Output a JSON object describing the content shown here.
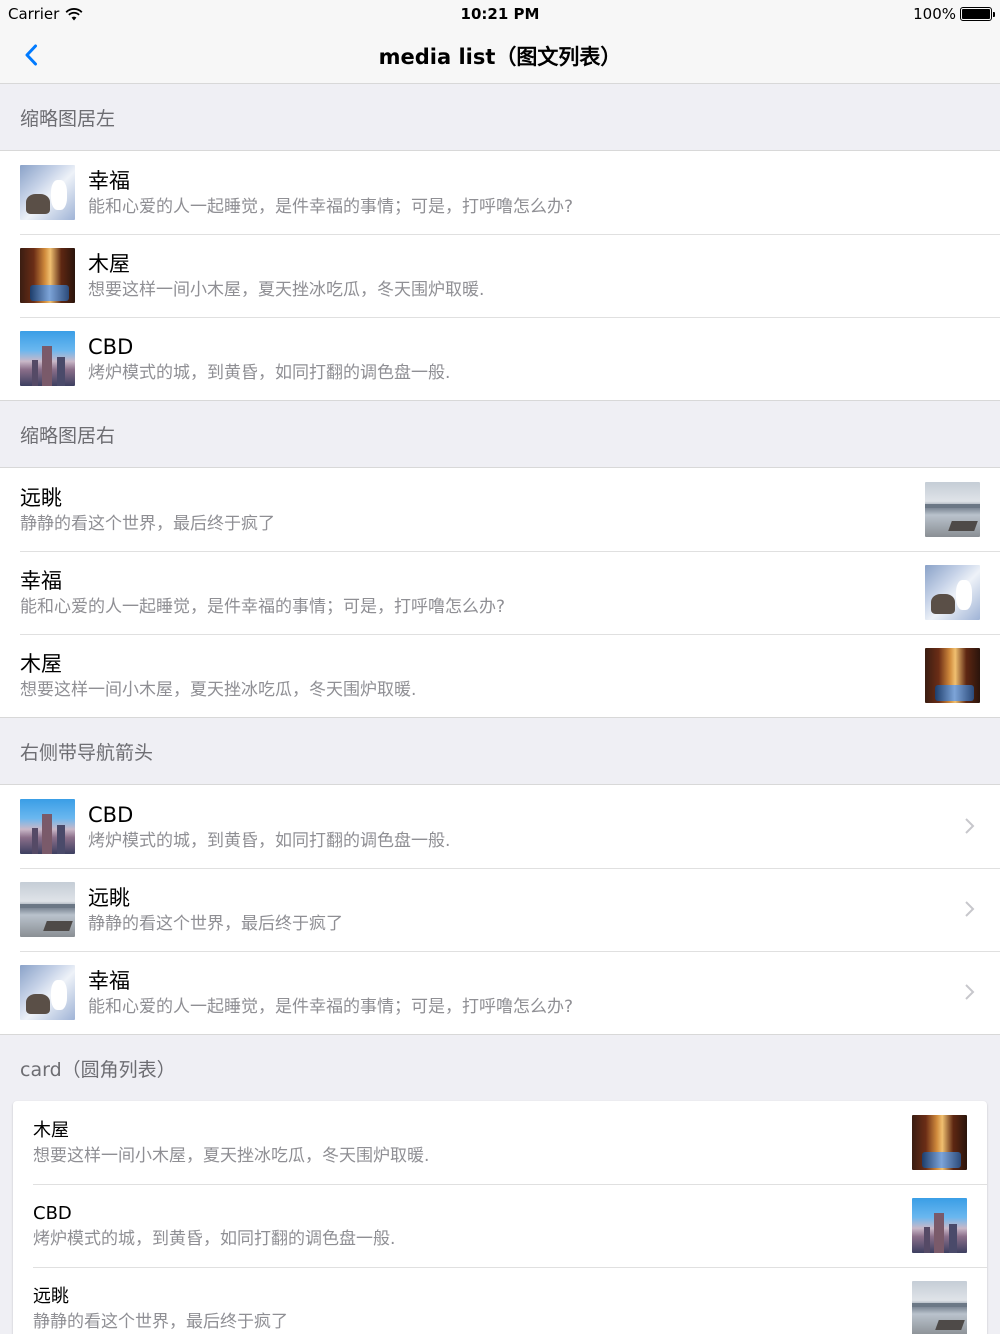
{
  "status_bar": {
    "carrier": "Carrier",
    "time": "10:21 PM",
    "battery": "100%"
  },
  "nav": {
    "title": "media list（图文列表）",
    "back_icon": "chevron-left-icon",
    "accent": "#007aff"
  },
  "sections": [
    {
      "header": "缩略图居左",
      "items": [
        {
          "title": "幸福",
          "subtitle": "能和心爱的人一起睡觉，是件幸福的事情；可是，打呼噜怎么办?",
          "thumb": "cat-image"
        },
        {
          "title": "木屋",
          "subtitle": "想要这样一间小木屋，夏天挫冰吃瓜，冬天围炉取暖.",
          "thumb": "cabin-image"
        },
        {
          "title": "CBD",
          "subtitle": "烤炉模式的城，到黄昏，如同打翻的调色盘一般.",
          "thumb": "cbd-image"
        }
      ]
    },
    {
      "header": "缩略图居右",
      "items": [
        {
          "title": "远眺",
          "subtitle": "静静的看这个世界，最后终于疯了",
          "thumb": "view-image"
        },
        {
          "title": "幸福",
          "subtitle": "能和心爱的人一起睡觉，是件幸福的事情；可是，打呼噜怎么办?",
          "thumb": "cat-image"
        },
        {
          "title": "木屋",
          "subtitle": "想要这样一间小木屋，夏天挫冰吃瓜，冬天围炉取暖.",
          "thumb": "cabin-image"
        }
      ]
    },
    {
      "header": "右侧带导航箭头",
      "items": [
        {
          "title": "CBD",
          "subtitle": "烤炉模式的城，到黄昏，如同打翻的调色盘一般.",
          "thumb": "cbd-image"
        },
        {
          "title": "远眺",
          "subtitle": "静静的看这个世界，最后终于疯了",
          "thumb": "view-image"
        },
        {
          "title": "幸福",
          "subtitle": "能和心爱的人一起睡觉，是件幸福的事情；可是，打呼噜怎么办?",
          "thumb": "cat-image"
        }
      ]
    },
    {
      "header": "card（圆角列表）",
      "items": [
        {
          "title": "木屋",
          "subtitle": "想要这样一间小木屋，夏天挫冰吃瓜，冬天围炉取暖.",
          "thumb": "cabin-image"
        },
        {
          "title": "CBD",
          "subtitle": "烤炉模式的城，到黄昏，如同打翻的调色盘一般.",
          "thumb": "cbd-image"
        },
        {
          "title": "远眺",
          "subtitle": "静静的看这个世界，最后终于疯了",
          "thumb": "view-image"
        }
      ]
    }
  ]
}
